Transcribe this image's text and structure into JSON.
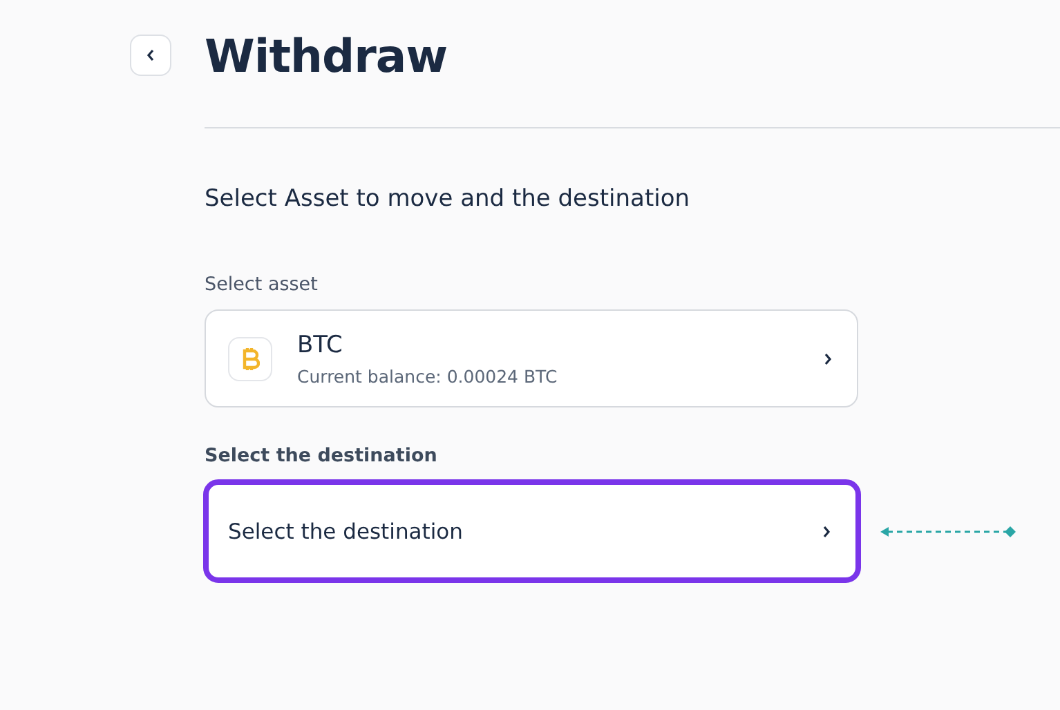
{
  "header": {
    "title": "Withdraw"
  },
  "subtitle": "Select Asset to move and the destination",
  "asset": {
    "label": "Select asset",
    "name": "BTC",
    "balance": "Current balance: 0.00024 BTC"
  },
  "destination": {
    "label": "Select the destination",
    "value": "Select the destination",
    "highlighted": true
  }
}
